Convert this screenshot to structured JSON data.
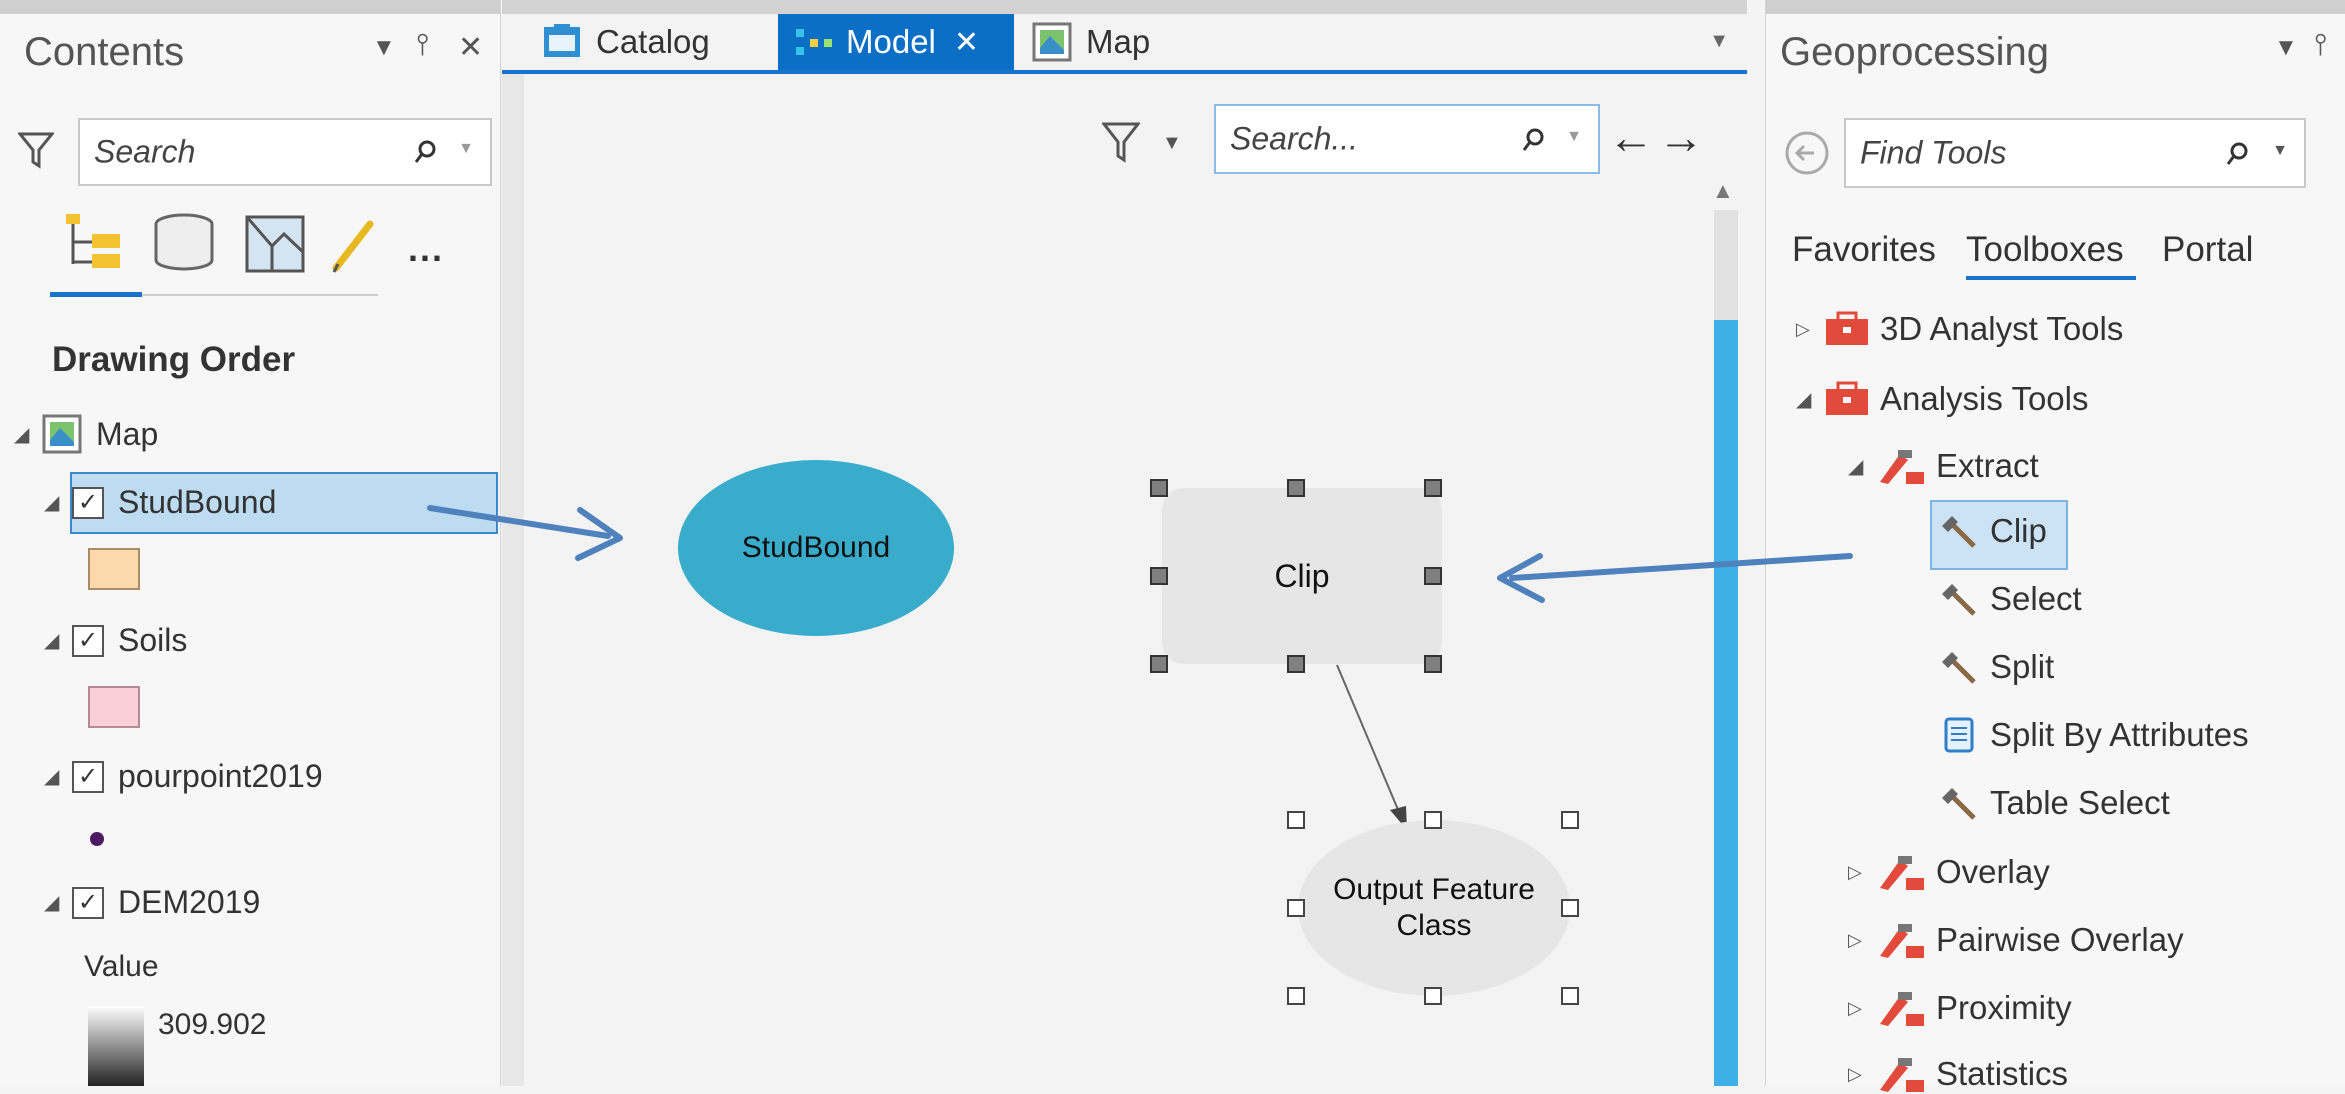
{
  "contents": {
    "title": "Contents",
    "search_placeholder": "Search",
    "section_title": "Drawing Order",
    "map_label": "Map",
    "layers": [
      {
        "label": "StudBound",
        "checked": true,
        "swatch": "#fcd9ac"
      },
      {
        "label": "Soils",
        "checked": true,
        "swatch": "#fbcfd8"
      },
      {
        "label": "pourpoint2019",
        "checked": true,
        "swatch": "#4b1a63"
      },
      {
        "label": "DEM2019",
        "checked": true
      }
    ],
    "legend_value_label": "Value",
    "legend_max": "309.902",
    "pin_glyph": "⫯",
    "close_glyph": "✕",
    "more_glyph": "..."
  },
  "tabs": [
    {
      "label": "Catalog",
      "icon": "catalog-icon",
      "active": false
    },
    {
      "label": "Model",
      "icon": "model-icon",
      "active": true
    },
    {
      "label": "Map",
      "icon": "map-icon",
      "active": false
    }
  ],
  "model": {
    "search_placeholder": "Search...",
    "nodes": {
      "input": {
        "label": "StudBound",
        "color": "#3aaccb"
      },
      "tool": {
        "label": "Clip",
        "color": "#e6e6e6"
      },
      "output": {
        "label_line1": "Output Feature",
        "label_line2": "Class",
        "color": "#e6e6e6"
      }
    },
    "arrow_color": "#4f81bd"
  },
  "geoprocessing": {
    "title": "Geoprocessing",
    "search_placeholder": "Find Tools",
    "tabs": [
      "Favorites",
      "Toolboxes",
      "Portal"
    ],
    "active_tab": "Toolboxes",
    "toolboxes": [
      {
        "label": "3D Analyst Tools",
        "expanded": false
      },
      {
        "label": "Analysis Tools",
        "expanded": true
      }
    ],
    "toolsets": [
      {
        "label": "Extract",
        "expanded": true
      },
      {
        "label": "Overlay",
        "expanded": false
      },
      {
        "label": "Pairwise Overlay",
        "expanded": false
      },
      {
        "label": "Proximity",
        "expanded": false
      },
      {
        "label": "Statistics",
        "expanded": false
      }
    ],
    "tools": [
      {
        "label": "Clip",
        "selected": true,
        "icon": "hammer-icon"
      },
      {
        "label": "Select",
        "selected": false,
        "icon": "hammer-icon"
      },
      {
        "label": "Split",
        "selected": false,
        "icon": "hammer-icon"
      },
      {
        "label": "Split By Attributes",
        "selected": false,
        "icon": "script-icon"
      },
      {
        "label": "Table Select",
        "selected": false,
        "icon": "hammer-icon"
      }
    ],
    "accent": "#1a73c6"
  }
}
